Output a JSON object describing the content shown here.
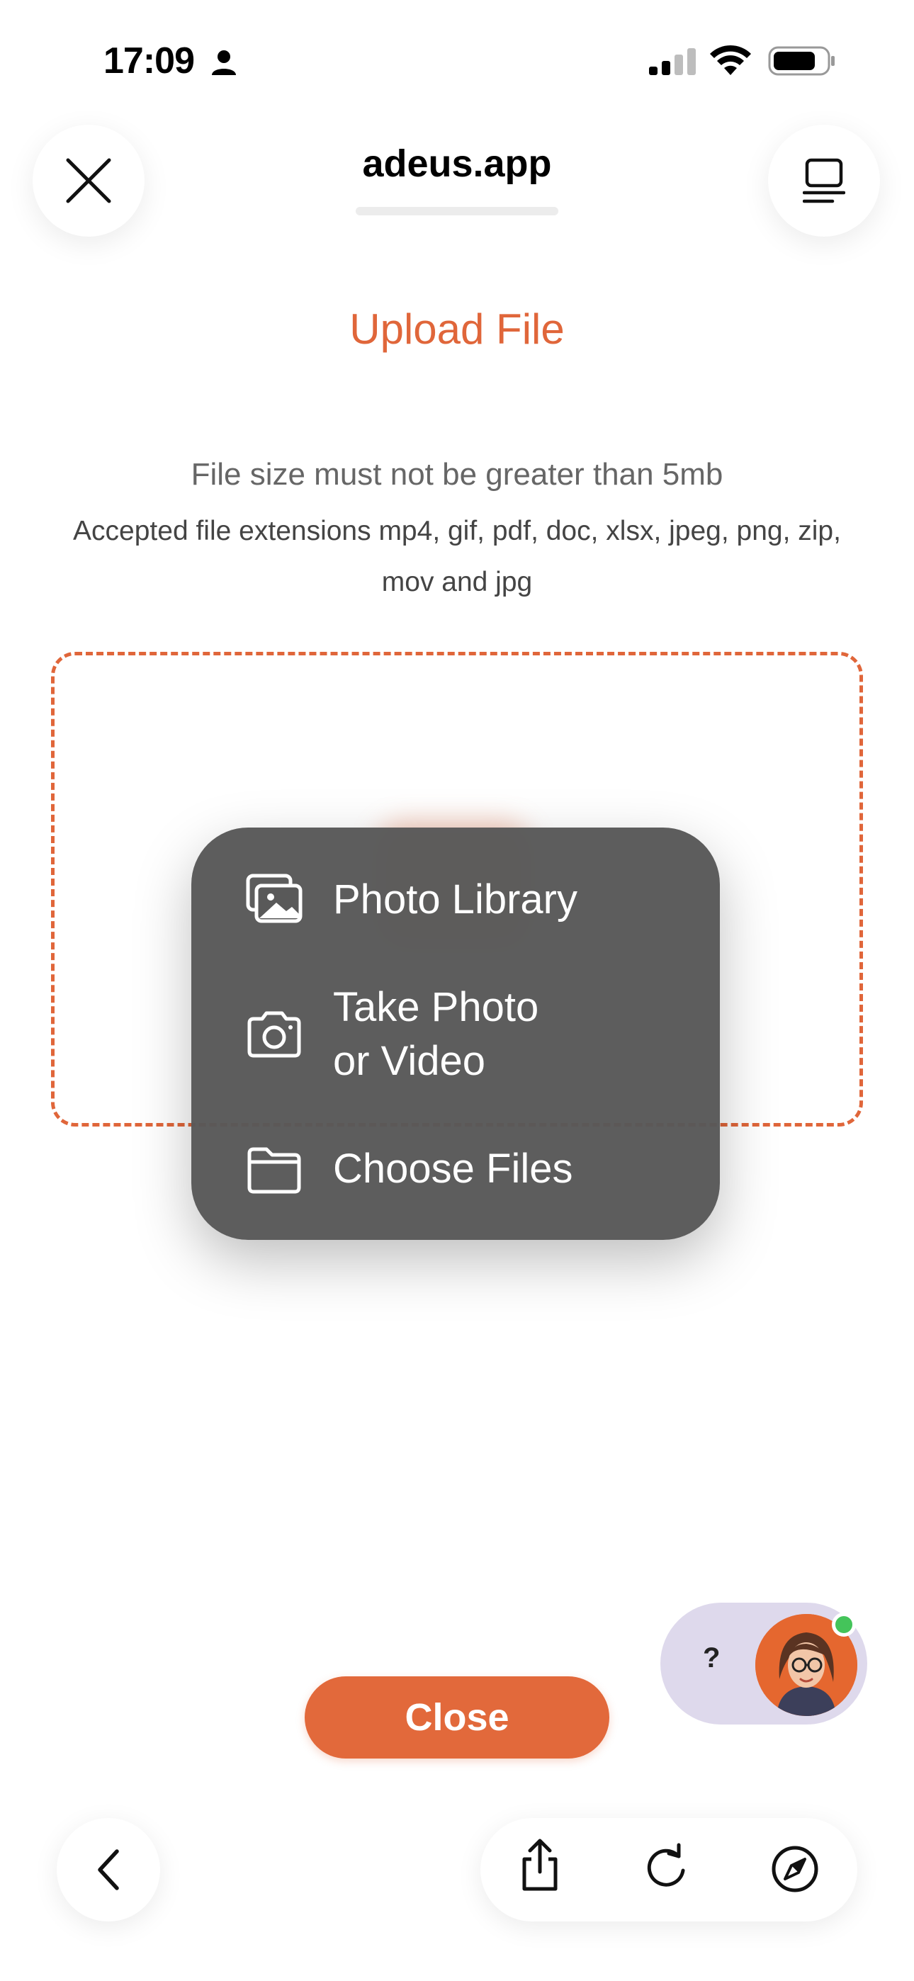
{
  "status_bar": {
    "time": "17:09",
    "icons": [
      "person-icon",
      "cellular-signal-icon",
      "wifi-icon",
      "battery-icon"
    ]
  },
  "browser": {
    "url": "adeus.app",
    "close_icon": "close-icon",
    "tabs_icon": "tab-overview-icon",
    "toolbar_icons": [
      "back-icon",
      "share-icon",
      "reload-icon",
      "compass-icon"
    ]
  },
  "page": {
    "title": "Upload File",
    "size_note": "File size must not be greater than 5mb",
    "extensions_note": "Accepted file extensions mp4, gif, pdf, doc, xlsx, jpeg, png, zip, mov and jpg",
    "close_label": "Close",
    "accent_color": "#e0663a"
  },
  "upload_menu": {
    "items": [
      {
        "label": "Photo Library",
        "icon": "photo-library-icon"
      },
      {
        "label": "Take Photo\nor Video",
        "icon": "camera-icon"
      },
      {
        "label": "Choose Files",
        "icon": "folder-icon"
      }
    ]
  },
  "chat_widget": {
    "label": "?",
    "status": "online"
  }
}
